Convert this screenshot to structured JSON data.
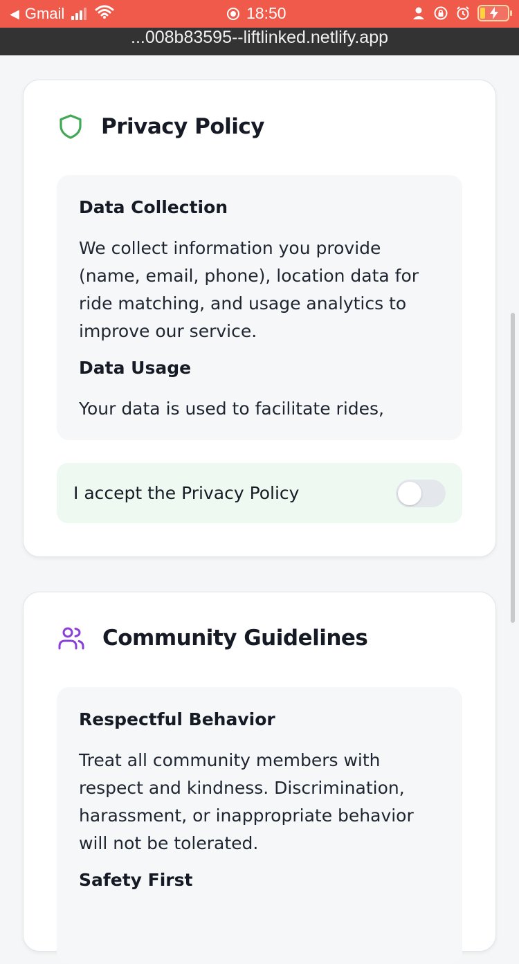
{
  "status_bar": {
    "back_app": "Gmail",
    "time": "18:50",
    "back_icon": "back-triangle-icon",
    "accent_color": "#ef5a4b"
  },
  "browser": {
    "url": "...008b83595--liftlinked.netlify.app"
  },
  "privacy_card": {
    "icon": "shield-icon",
    "icon_color": "#43a856",
    "title": "Privacy Policy",
    "sections": [
      {
        "heading": "Data Collection",
        "text": "We collect information you provide (name, email, phone), location data for ride matching, and usage analytics to improve our service."
      },
      {
        "heading": "Data Usage",
        "text": "Your data is used to facilitate rides,"
      }
    ],
    "accept_label": "I accept the Privacy Policy",
    "accept_checked": false
  },
  "community_card": {
    "icon": "users-icon",
    "icon_color": "#8b3fd9",
    "title": "Community Guidelines",
    "sections": [
      {
        "heading": "Respectful Behavior",
        "text": "Treat all community members with respect and kindness. Discrimination, harassment, or inappropriate behavior will not be tolerated."
      },
      {
        "heading": "Safety First",
        "text": ""
      }
    ]
  }
}
